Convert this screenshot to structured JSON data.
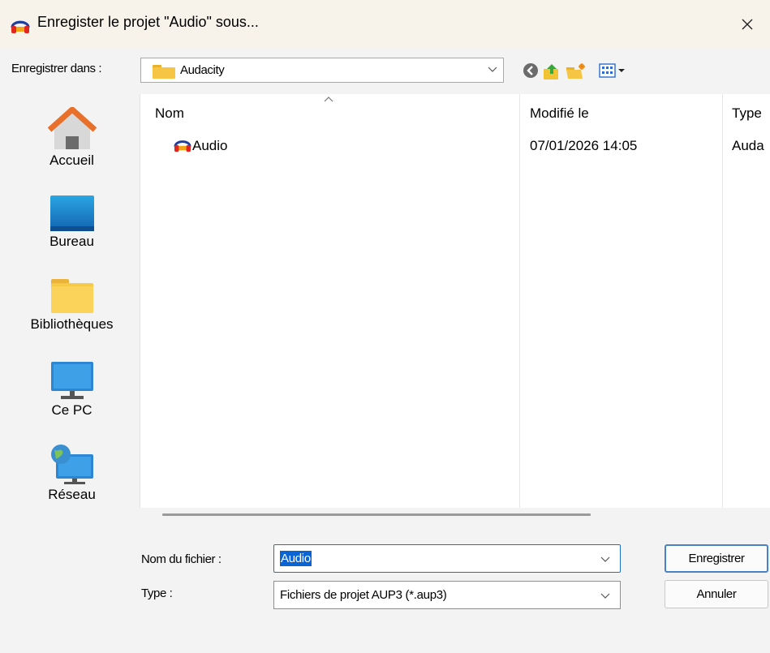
{
  "window": {
    "title": "Enregister le projet \"Audio\" sous...",
    "close_glyph": "✕"
  },
  "look_in": {
    "label": "Enregistrer dans :",
    "value": "Audacity"
  },
  "toolbar": {
    "icons": [
      "back-icon",
      "up-folder-icon",
      "new-folder-icon",
      "view-menu-icon"
    ]
  },
  "places": [
    {
      "label": "Accueil",
      "icon": "home-icon"
    },
    {
      "label": "Bureau",
      "icon": "desktop-icon"
    },
    {
      "label": "Bibliothèques",
      "icon": "libraries-folder-icon"
    },
    {
      "label": "Ce PC",
      "icon": "computer-icon"
    },
    {
      "label": "Réseau",
      "icon": "network-icon"
    }
  ],
  "file_list": {
    "columns": [
      "Nom",
      "Modifié le",
      "Type"
    ],
    "rows": [
      {
        "name": "Audio",
        "modified": "07/01/2026 14:05",
        "type": "Auda",
        "icon": "audacity-headphones-icon"
      }
    ]
  },
  "file_name": {
    "label": "Nom du fichier :",
    "value": "Audio"
  },
  "file_type": {
    "label": "Type :",
    "value": "Fichiers de projet AUP3 (*.aup3)"
  },
  "buttons": {
    "save": "Enregistrer",
    "cancel": "Annuler"
  },
  "colors": {
    "accent": "#0a64d3",
    "titlebar": "#f7f3ea"
  }
}
